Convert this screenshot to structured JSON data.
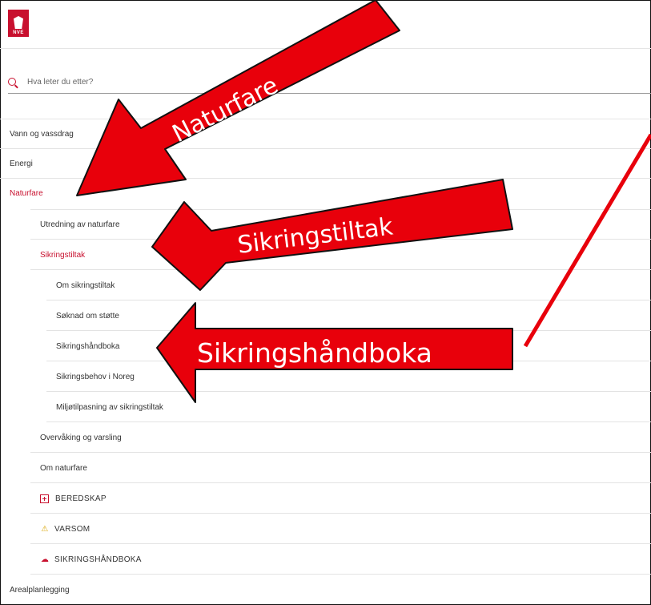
{
  "brand": {
    "logo_text": "NVE"
  },
  "search": {
    "placeholder": "Hva leter du etter?"
  },
  "menu": {
    "vann": "Vann og vassdrag",
    "energi": "Energi",
    "naturfare": "Naturfare",
    "utredning": "Utredning av naturfare",
    "sikringstiltak": "Sikringstiltak",
    "om_sikringstiltak": "Om sikringstiltak",
    "soknad": "Søknad om støtte",
    "handboka": "Sikringshåndboka",
    "behov": "Sikringsbehov i Noreg",
    "miljo": "Miljøtilpasning av sikringstiltak",
    "overvaking": "Overvåking og varsling",
    "om_naturfare": "Om naturfare",
    "beredskap": "BEREDSKAP",
    "varsom": "VARSOM",
    "handboka_ext": "SIKRINGSHÅNDBOKA",
    "arealplan": "Arealplanlegging"
  },
  "annotations": {
    "arrow1": "Naturfare",
    "arrow2": "Sikringstiltak",
    "arrow3": "Sikringshåndboka",
    "arrow_color": "#e8000b"
  },
  "colors": {
    "accent": "#c8102e"
  }
}
